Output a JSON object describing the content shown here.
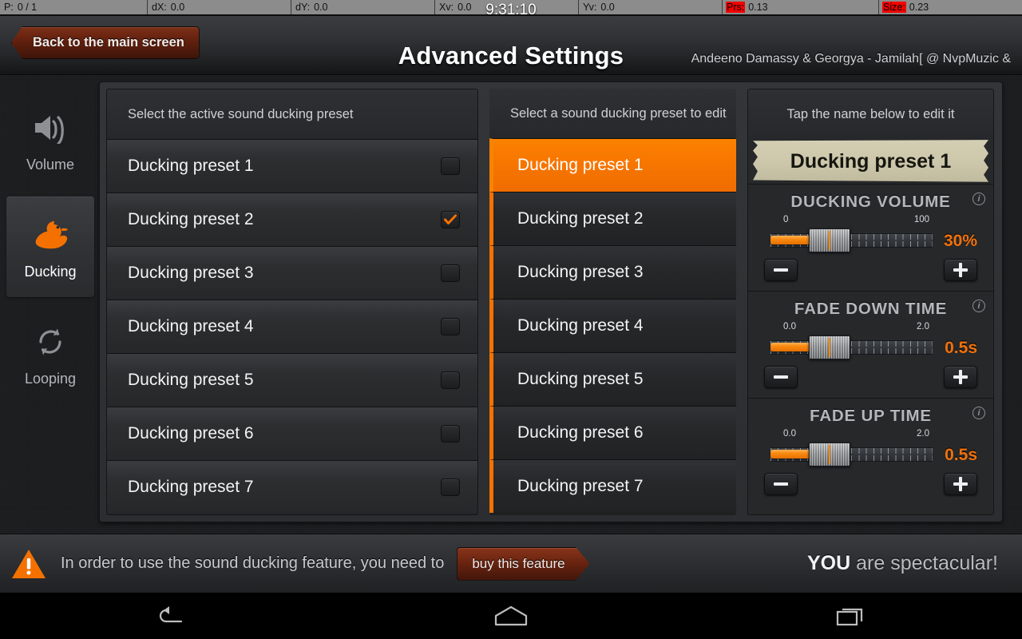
{
  "statusbar": {
    "cells": [
      {
        "key": "P:",
        "value": "0 / 1",
        "hot": false
      },
      {
        "key": "dX:",
        "value": "0.0",
        "hot": false
      },
      {
        "key": "dY:",
        "value": "0.0",
        "hot": false
      },
      {
        "key": "Xv:",
        "value": "0.0",
        "hot": false
      },
      {
        "key": "Yv:",
        "value": "0.0",
        "hot": false
      },
      {
        "key": "Prs:",
        "value": "0.13",
        "hot": true
      },
      {
        "key": "Size:",
        "value": "0.23",
        "hot": true
      }
    ],
    "clock": "9:31:10"
  },
  "header": {
    "back_label": "Back to the main screen",
    "title": "Advanced Settings",
    "track": "Andeeno Damassy & Georgya - Jamilah[ @ NvpMuzic &"
  },
  "sidebar": {
    "items": [
      {
        "label": "Volume",
        "icon": "speaker-icon",
        "active": false
      },
      {
        "label": "Ducking",
        "icon": "duck-icon",
        "active": true
      },
      {
        "label": "Looping",
        "icon": "loop-icon",
        "active": false
      }
    ]
  },
  "active_list": {
    "header": "Select the active sound ducking preset",
    "rows": [
      {
        "label": "Ducking preset 1",
        "checked": false
      },
      {
        "label": "Ducking preset 2",
        "checked": true
      },
      {
        "label": "Ducking preset 3",
        "checked": false
      },
      {
        "label": "Ducking preset 4",
        "checked": false
      },
      {
        "label": "Ducking preset 5",
        "checked": false
      },
      {
        "label": "Ducking preset 6",
        "checked": false
      },
      {
        "label": "Ducking preset 7",
        "checked": false
      }
    ]
  },
  "edit_list": {
    "header": "Select a sound ducking preset to edit",
    "rows": [
      {
        "label": "Ducking preset 1",
        "selected": true
      },
      {
        "label": "Ducking preset 2",
        "selected": false
      },
      {
        "label": "Ducking preset 3",
        "selected": false
      },
      {
        "label": "Ducking preset 4",
        "selected": false
      },
      {
        "label": "Ducking preset 5",
        "selected": false
      },
      {
        "label": "Ducking preset 6",
        "selected": false
      },
      {
        "label": "Ducking preset 7",
        "selected": false
      }
    ]
  },
  "editor": {
    "header": "Tap the name below  to edit it",
    "name": "Ducking preset 1",
    "controls": [
      {
        "title": "DUCKING VOLUME",
        "min_label": "0",
        "max_label": "100",
        "value_label": "30%",
        "fill_percent": 30,
        "info": "info-icon",
        "minus": "−",
        "plus": "+"
      },
      {
        "title": "FADE DOWN TIME",
        "min_label": "0.0",
        "max_label": "2.0",
        "value_label": "0.5s",
        "fill_percent": 30,
        "info": "info-icon",
        "minus": "−",
        "plus": "+"
      },
      {
        "title": "FADE UP TIME",
        "min_label": "0.0",
        "max_label": "2.0",
        "value_label": "0.5s",
        "fill_percent": 30,
        "info": "info-icon",
        "minus": "−",
        "plus": "+"
      }
    ]
  },
  "promo": {
    "message": "In order to use the sound ducking feature, you need to",
    "buy_label": "buy this feature",
    "praise_strong": "YOU",
    "praise_rest": " are spectacular!"
  },
  "navbar": {
    "back": "back-icon",
    "home": "home-icon",
    "recents": "recents-icon"
  },
  "colors": {
    "accent": "#f47100",
    "accent_bright": "#fb8200",
    "panel": "#2b2d30",
    "alert_red": "#f20000",
    "tape": "#cdc7ab"
  }
}
